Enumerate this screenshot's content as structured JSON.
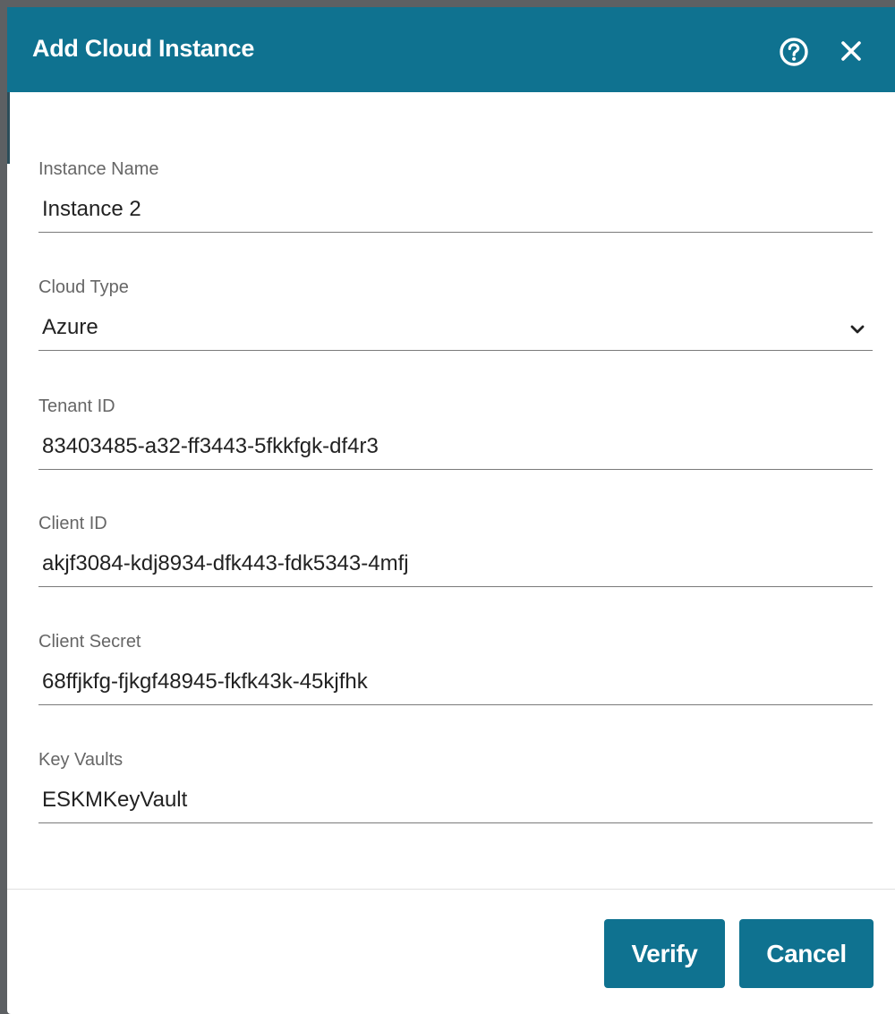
{
  "dialog": {
    "title": "Add Cloud Instance",
    "help_icon": "help-circle-icon",
    "close_icon": "close-icon"
  },
  "fields": {
    "instance_name": {
      "label": "Instance Name",
      "value": "Instance 2"
    },
    "cloud_type": {
      "label": "Cloud Type",
      "value": "Azure",
      "icon": "chevron-down-icon"
    },
    "tenant_id": {
      "label": "Tenant ID",
      "value": "83403485-a32-ff3443-5fkkfgk-df4r3"
    },
    "client_id": {
      "label": "Client ID",
      "value": "akjf3084-kdj8934-dfk443-fdk5343-4mfj"
    },
    "client_secret": {
      "label": "Client Secret",
      "value": "68ffjkfg-fjkgf48945-fkfk43k-45kjfhk"
    },
    "key_vaults": {
      "label": "Key Vaults",
      "value": "ESKMKeyVault"
    }
  },
  "buttons": {
    "verify": "Verify",
    "cancel": "Cancel"
  },
  "colors": {
    "primary": "#0f7290",
    "backdrop": "#5d6063",
    "label": "#666666",
    "text": "#222222"
  }
}
